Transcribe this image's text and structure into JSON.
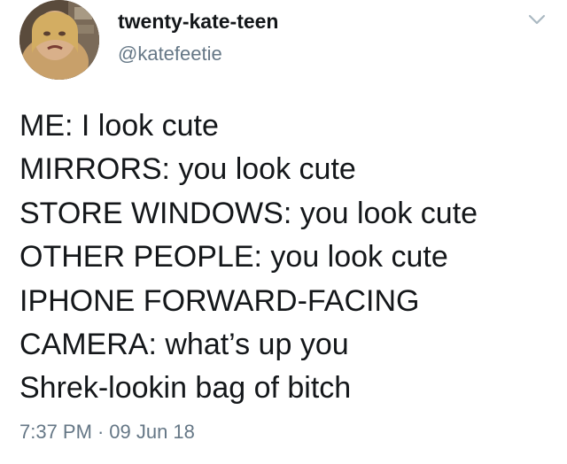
{
  "author": {
    "display_name": "twenty-kate-teen",
    "handle": "@katefeetie"
  },
  "icons": {
    "avatar": "profile-photo",
    "menu": "chevron-down-icon"
  },
  "tweet": {
    "lines": [
      "ME: I look cute",
      "MIRRORS: you look cute",
      "STORE WINDOWS: you look cute",
      "OTHER PEOPLE: you look cute",
      "IPHONE FORWARD-FACING",
      "CAMERA: what’s up you",
      "Shrek-lookin bag of bitch"
    ]
  },
  "meta": {
    "time": "7:37 PM",
    "separator": "·",
    "date": "09 Jun 18"
  },
  "colors": {
    "text": "#14171a",
    "secondary": "#657786",
    "background": "#ffffff"
  }
}
